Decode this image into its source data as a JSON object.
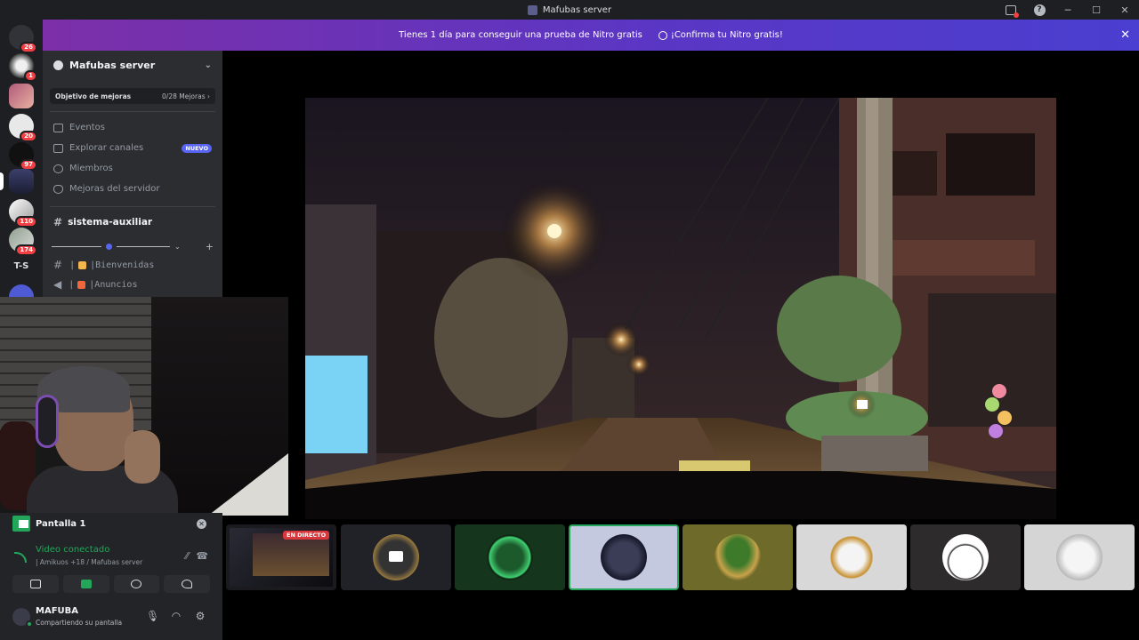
{
  "window": {
    "title": "Mafubas server"
  },
  "banner": {
    "message": "Tienes 1 día para conseguir una prueba de Nitro gratis",
    "cta": "¡Confirma tu Nitro gratis!",
    "close": "✕"
  },
  "guilds": [
    {
      "name": "discord-home",
      "badge": "26"
    },
    {
      "name": "guild-1",
      "badge": "1"
    },
    {
      "name": "guild-2",
      "badge": ""
    },
    {
      "name": "guild-3",
      "badge": "20"
    },
    {
      "name": "guild-4",
      "badge": "97"
    },
    {
      "name": "guild-mafubas",
      "badge": ""
    },
    {
      "name": "guild-6",
      "badge": "110"
    },
    {
      "name": "guild-7",
      "badge": "174"
    },
    {
      "name": "guild-ts",
      "text": "T-S"
    }
  ],
  "sidebar": {
    "server_name": "Mafubas server",
    "boost": {
      "label": "Objetivo de mejoras",
      "progress": "0/28 Mejoras"
    },
    "nav": [
      {
        "label": "Eventos"
      },
      {
        "label": "Explorar canales",
        "badge": "NUEVO"
      },
      {
        "label": "Miembros"
      },
      {
        "label": "Mejoras del servidor"
      }
    ],
    "top_channel": "sistema-auxiliar",
    "channels": [
      {
        "label": "Bienvenidas",
        "prefix": "|",
        "sep": "|"
      },
      {
        "label": "Anuncios",
        "prefix": "|",
        "sep": "|"
      }
    ]
  },
  "tiles": [
    {
      "name": "stream-preview",
      "live": "EN DIRECTO"
    },
    {
      "name": "participant-camera"
    },
    {
      "name": "participant-gg"
    },
    {
      "name": "participant-wolf"
    },
    {
      "name": "participant-watermelon"
    },
    {
      "name": "participant-stormtrooper"
    },
    {
      "name": "participant-cartoon"
    },
    {
      "name": "participant-dog"
    }
  ],
  "panel": {
    "screen_label": "Pantalla 1",
    "voice_status": "Video conectado",
    "voice_sub": "| Amikuos +18 / Mafubas server",
    "user_name": "MAFUBA",
    "user_status": "Compartiendo su pantalla"
  },
  "colors": {
    "accent_green": "#23a55a",
    "badge_red": "#f23f43",
    "blurple": "#5865f2",
    "live_red": "#da373c"
  }
}
